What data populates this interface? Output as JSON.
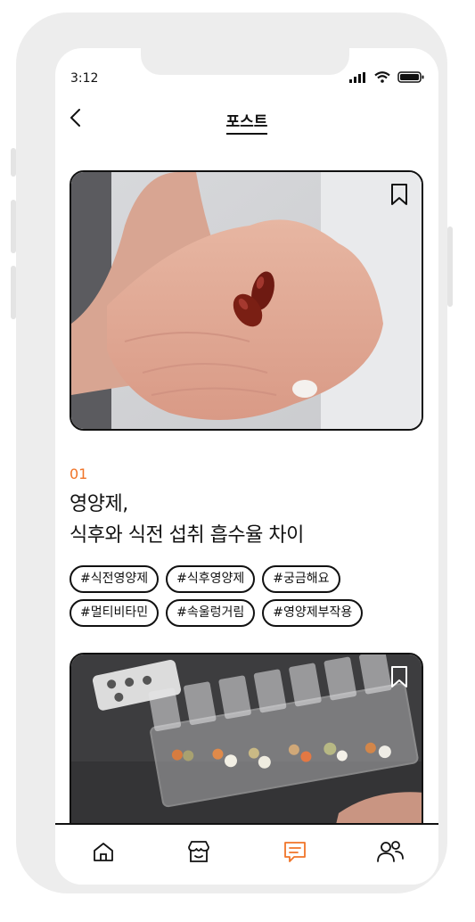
{
  "status_bar": {
    "time": "3:12"
  },
  "header": {
    "title": "포스트"
  },
  "post": {
    "number": "01",
    "title_line1": "영양제,",
    "title_line2": "식후와 식전 섭취 흡수율 차이",
    "tags": [
      "#식전영양제",
      "#식후영양제",
      "#궁금해요",
      "#멀티비타민",
      "#속울렁거림",
      "#영양제부작용"
    ]
  },
  "icons": {
    "back": "chevron-left-icon",
    "bookmark": "bookmark-icon",
    "nav": [
      "home-icon",
      "store-icon",
      "chat-icon",
      "people-icon"
    ]
  },
  "colors": {
    "accent": "#f07428",
    "active_nav": "#f07428",
    "text": "#111111"
  }
}
